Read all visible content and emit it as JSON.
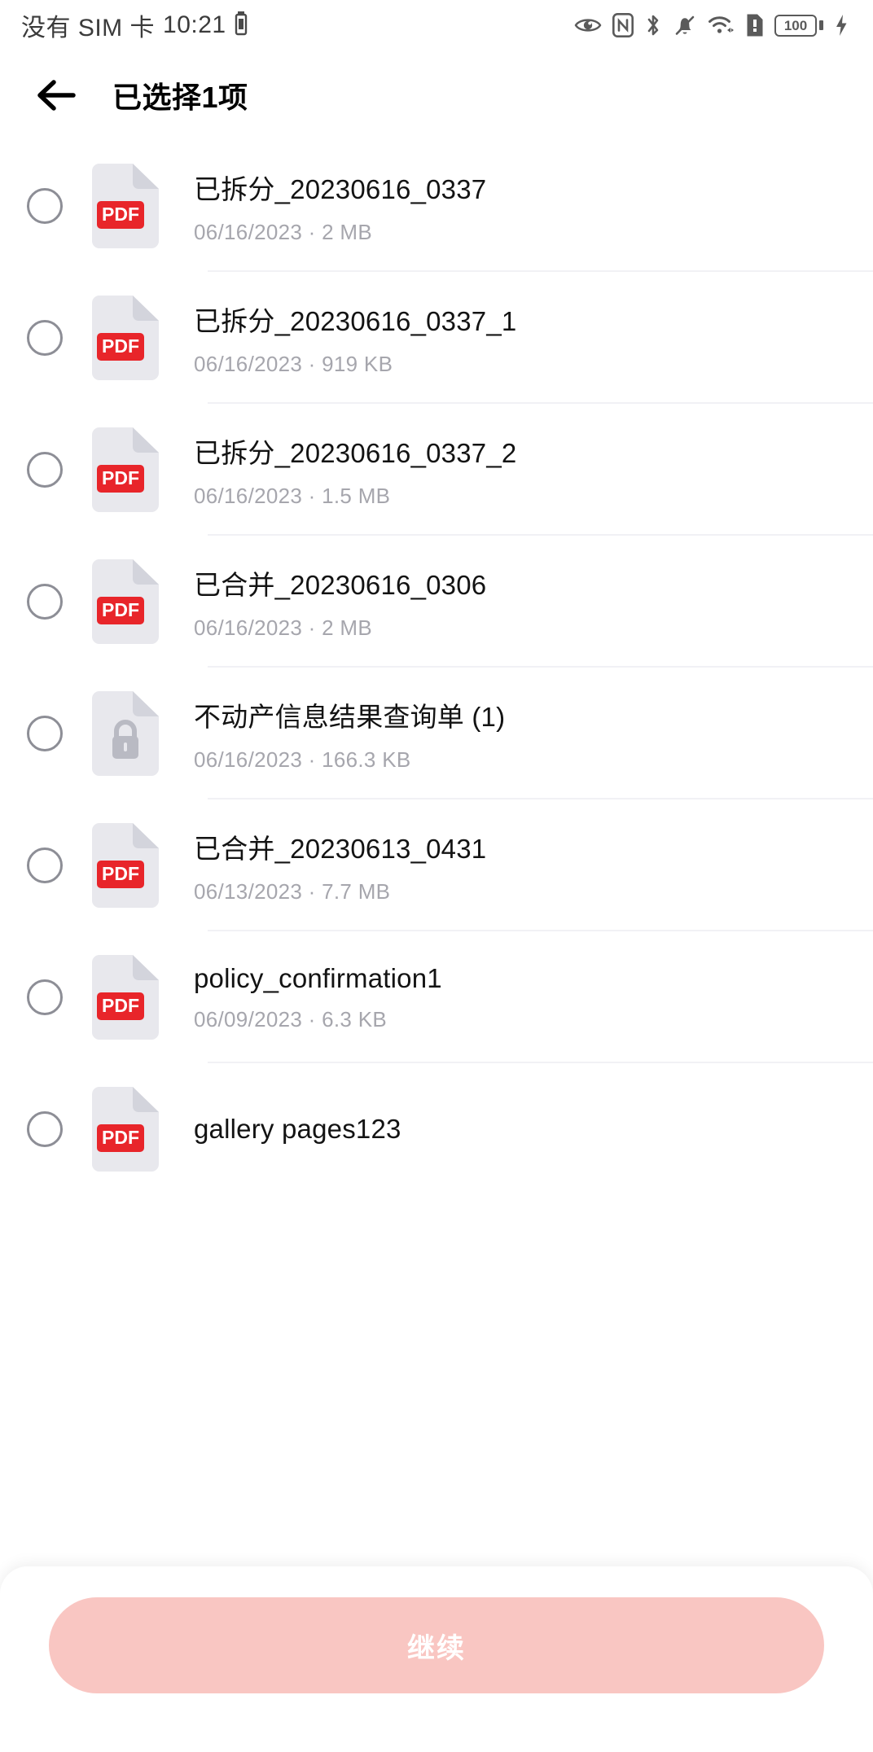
{
  "status_bar": {
    "carrier": "没有 SIM 卡",
    "time": "10:21",
    "battery_level": "100",
    "icons": [
      "alarm-icon",
      "eye-care-icon",
      "nfc-icon",
      "bluetooth-icon",
      "mute-bell-icon",
      "wifi-icon",
      "sim-alert-icon",
      "battery-icon",
      "charging-bolt-icon"
    ]
  },
  "app_bar": {
    "back_label": "back-arrow",
    "title": "已选择1项"
  },
  "files": [
    {
      "name": "已拆分_20230616_0337",
      "date": "06/16/2023",
      "size": "2 MB",
      "sub": "06/16/2023 · 2 MB",
      "type": "pdf",
      "selected": false
    },
    {
      "name": "已拆分_20230616_0337_1",
      "date": "06/16/2023",
      "size": "919 KB",
      "sub": "06/16/2023 · 919 KB",
      "type": "pdf",
      "selected": false
    },
    {
      "name": "已拆分_20230616_0337_2",
      "date": "06/16/2023",
      "size": "1.5 MB",
      "sub": "06/16/2023 · 1.5 MB",
      "type": "pdf",
      "selected": false
    },
    {
      "name": "已合并_20230616_0306",
      "date": "06/16/2023",
      "size": "2 MB",
      "sub": "06/16/2023 · 2 MB",
      "type": "pdf",
      "selected": false
    },
    {
      "name": "不动产信息结果查询单 (1)",
      "date": "06/16/2023",
      "size": "166.3 KB",
      "sub": "06/16/2023 · 166.3 KB",
      "type": "locked",
      "selected": false
    },
    {
      "name": "已合并_20230613_0431",
      "date": "06/13/2023",
      "size": "7.7 MB",
      "sub": "06/13/2023 · 7.7 MB",
      "type": "pdf",
      "selected": false
    },
    {
      "name": "policy_confirmation1",
      "date": "06/09/2023",
      "size": "6.3 KB",
      "sub": "06/09/2023 · 6.3 KB",
      "type": "pdf",
      "selected": false
    },
    {
      "name": "gallery pages123",
      "date": "",
      "size": "",
      "sub": "",
      "type": "pdf",
      "selected": false
    }
  ],
  "bottom_bar": {
    "continue_label": "继续"
  },
  "colors": {
    "pdf_red": "#e8252a",
    "cta_pink": "#f9c6c2",
    "doc_gray": "#e8e8ed",
    "text_primary": "#131313",
    "text_secondary": "#a6a6ad",
    "divider": "#f1f1f5",
    "checkbox_border": "#8d8e96"
  }
}
